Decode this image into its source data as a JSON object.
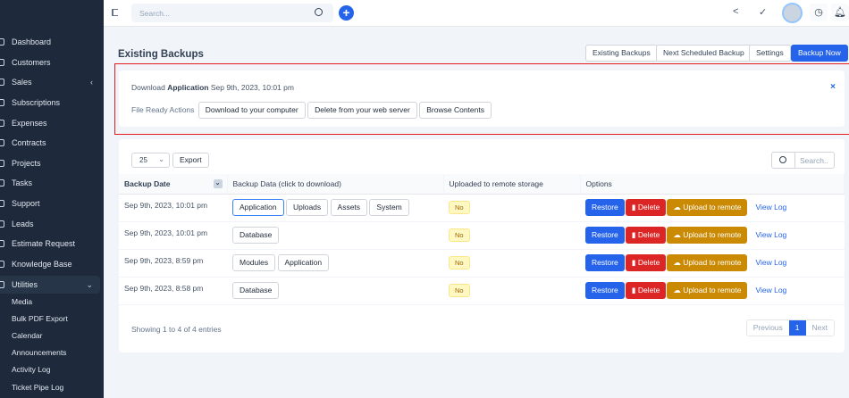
{
  "sidebar": {
    "items": [
      {
        "label": "Dashboard",
        "icon": "home-icon"
      },
      {
        "label": "Customers",
        "icon": "user-icon"
      },
      {
        "label": "Sales",
        "icon": "receipt-icon",
        "chevron": "‹"
      },
      {
        "label": "Subscriptions",
        "icon": "refresh-icon"
      },
      {
        "label": "Expenses",
        "icon": "file-icon"
      },
      {
        "label": "Contracts",
        "icon": "document-icon"
      },
      {
        "label": "Projects",
        "icon": "chart-icon"
      },
      {
        "label": "Tasks",
        "icon": "check-icon"
      },
      {
        "label": "Support",
        "icon": "lifebuoy-icon"
      },
      {
        "label": "Leads",
        "icon": "tty-icon"
      },
      {
        "label": "Estimate Request",
        "icon": "clipboard-icon"
      },
      {
        "label": "Knowledge Base",
        "icon": "book-icon"
      },
      {
        "label": "Utilities",
        "icon": "cogs-icon",
        "chevron": "⌄",
        "active": true
      }
    ],
    "sub_items": [
      "Media",
      "Bulk PDF Export",
      "Calendar",
      "Announcements",
      "Activity Log",
      "Ticket Pipe Log"
    ]
  },
  "header": {
    "search_placeholder": "Search..."
  },
  "page": {
    "title": "Existing Backups",
    "tabs": [
      "Existing Backups",
      "Next Scheduled Backup",
      "Settings",
      "Backup Now"
    ]
  },
  "download": {
    "prefix": "Download",
    "type": "Application",
    "date": "Sep 9th, 2023, 10:01 pm",
    "actions_label": "File Ready Actions",
    "actions": [
      "Download to your computer",
      "Delete from your web server",
      "Browse Contents"
    ],
    "close": "×"
  },
  "table": {
    "page_length": "25",
    "export": "Export",
    "search_placeholder": "Search..",
    "columns": [
      "Backup Date",
      "Backup Data (click to download)",
      "Uploaded to remote storage",
      "Options"
    ],
    "rows": [
      {
        "date": "Sep 9th, 2023, 10:01 pm",
        "data": [
          "Application",
          "Uploads",
          "Assets",
          "System"
        ],
        "uploaded": "No"
      },
      {
        "date": "Sep 9th, 2023, 10:01 pm",
        "data": [
          "Database"
        ],
        "uploaded": "No"
      },
      {
        "date": "Sep 9th, 2023, 8:59 pm",
        "data": [
          "Modules",
          "Application"
        ],
        "uploaded": "No"
      },
      {
        "date": "Sep 9th, 2023, 8:58 pm",
        "data": [
          "Database"
        ],
        "uploaded": "No"
      }
    ],
    "options": {
      "restore": "Restore",
      "delete": "Delete",
      "upload": "Upload to remote",
      "view_log": "View Log"
    },
    "info": "Showing 1 to 4 of 4 entries",
    "pagination": {
      "previous": "Previous",
      "current": "1",
      "next": "Next"
    }
  }
}
